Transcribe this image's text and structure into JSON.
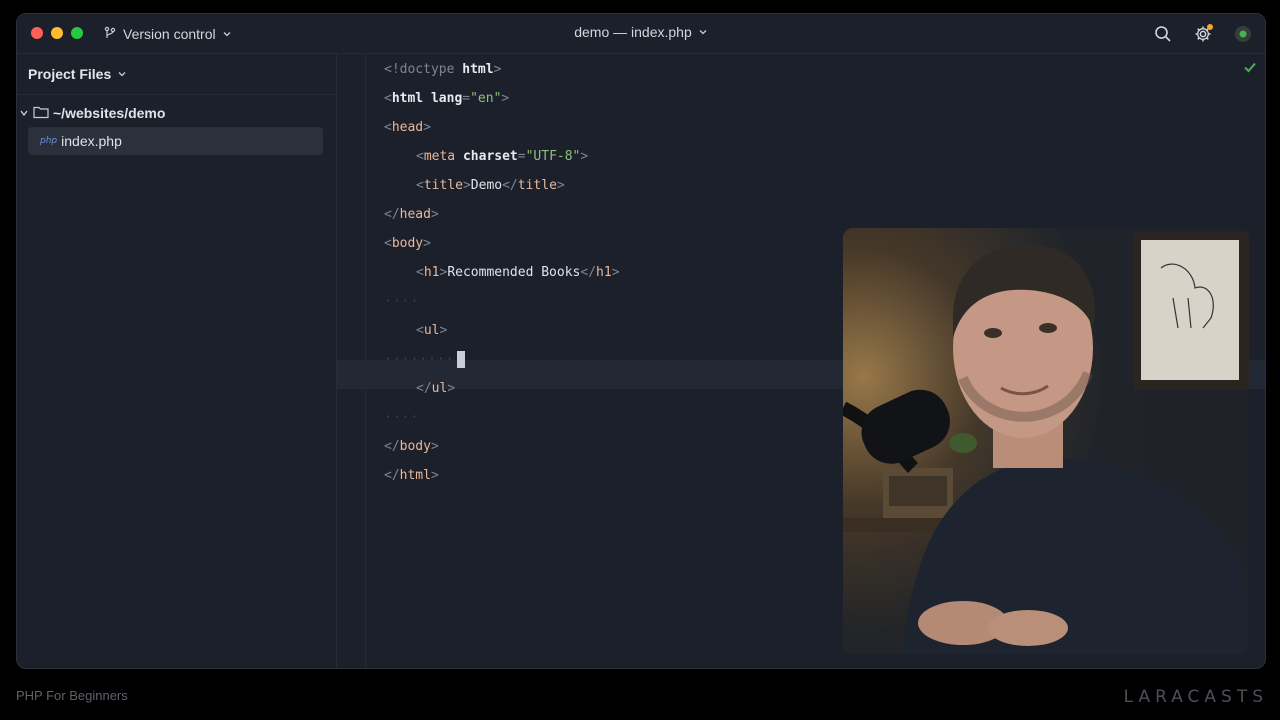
{
  "titlebar": {
    "vcs_label": "Version control",
    "window_title": "demo — index.php"
  },
  "sidebar": {
    "header": "Project Files",
    "folder": "~/websites/demo",
    "file_badge": "php",
    "file": "index.php"
  },
  "editor": {
    "lines": {
      "l1_a": "<!doctype ",
      "l1_b": "html",
      "l1_c": ">",
      "l2_open": "<",
      "l2_tag": "html",
      "l2_attr": "lang",
      "l2_eq": "=",
      "l2_val": "\"en\"",
      "l2_close": ">",
      "l3_open": "<",
      "l3_tag": "head",
      "l3_close": ">",
      "l4_open": "<",
      "l4_tag": "meta",
      "l4_attr": "charset",
      "l4_eq": "=",
      "l4_val": "\"UTF-8\"",
      "l4_close": ">",
      "l5_open": "<",
      "l5_tag": "title",
      "l5_close": ">",
      "l5_text": "Demo",
      "l5_end_open": "</",
      "l5_end_tag": "title",
      "l5_end_close": ">",
      "l6_open": "</",
      "l6_tag": "head",
      "l6_close": ">",
      "l7_open": "<",
      "l7_tag": "body",
      "l7_close": ">",
      "l8_open": "<",
      "l8_tag": "h1",
      "l8_close": ">",
      "l8_text": "Recommended Books",
      "l8_end_open": "</",
      "l8_end_tag": "h1",
      "l8_end_close": ">",
      "l9_ws": "····",
      "l10_open": "<",
      "l10_tag": "ul",
      "l10_close": ">",
      "l11_ws": "········",
      "l12_open": "</",
      "l12_tag": "ul",
      "l12_close": ">",
      "l13_ws": "····",
      "l14_open": "</",
      "l14_tag": "body",
      "l14_close": ">",
      "l15_open": "</",
      "l15_tag": "html",
      "l15_close": ">"
    }
  },
  "footer": {
    "course": "PHP For Beginners",
    "brand": "LARACASTS"
  },
  "colors": {
    "background": "#1c202a",
    "tag": "#e6b89c",
    "string": "#8ec07c",
    "accent_check": "#4caf50"
  }
}
